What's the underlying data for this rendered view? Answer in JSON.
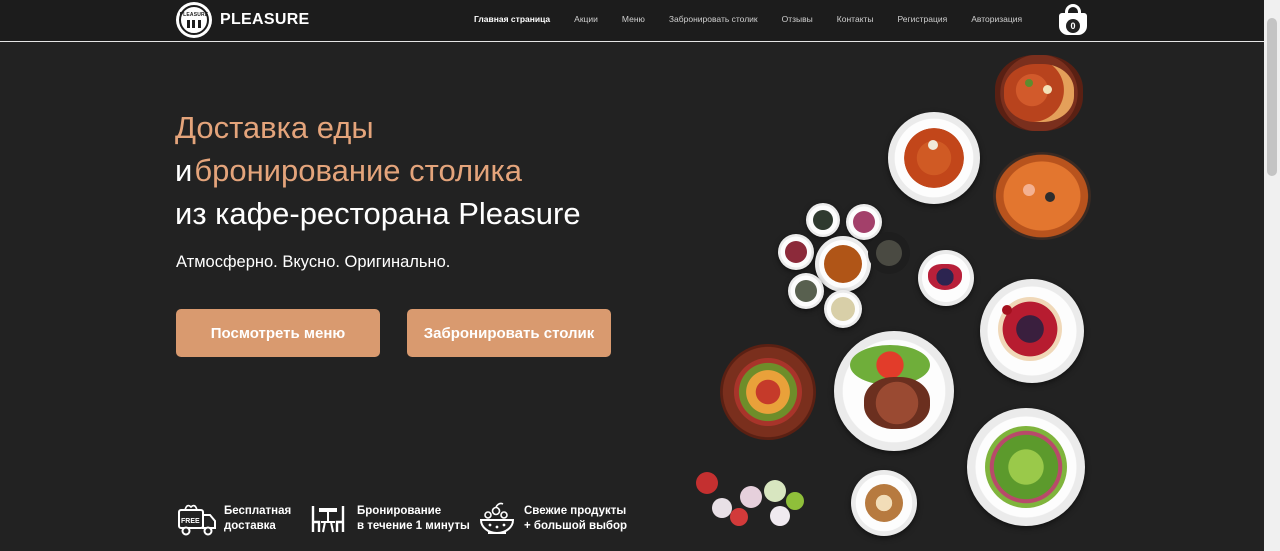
{
  "header": {
    "brand": "PLEASURE",
    "badge_text": "PLEASURE",
    "nav": [
      {
        "label": "Главная страница",
        "active": true
      },
      {
        "label": "Акции"
      },
      {
        "label": "Меню"
      },
      {
        "label": "Забронировать столик"
      },
      {
        "label": "Отзывы"
      },
      {
        "label": "Контакты"
      },
      {
        "label": "Регистрация"
      },
      {
        "label": "Авторизация"
      }
    ],
    "cart_count": "0"
  },
  "hero": {
    "line1": "Доставка еды",
    "line2_prefix": "и",
    "line2_accent": "бронирование столика",
    "line3": "из кафе-ресторана Pleasure",
    "tagline": "Атмосферно. Вкусно. Оригинально.",
    "btn_menu": "Посмотреть меню",
    "btn_book": "Забронировать столик"
  },
  "features": [
    {
      "icon": "free-delivery-truck-icon",
      "line1": "Бесплатная",
      "line2": "доставка",
      "badge": "FREE"
    },
    {
      "icon": "table-booking-icon",
      "line1": "Бронирование",
      "line2": "в течение 1 минуты"
    },
    {
      "icon": "fresh-bowl-icon",
      "line1": "Свежие продукты",
      "line2": "+ большой выбор"
    }
  ],
  "colors": {
    "accent": "#e4a47b",
    "button": "#d99a6f",
    "background": "#222222"
  }
}
